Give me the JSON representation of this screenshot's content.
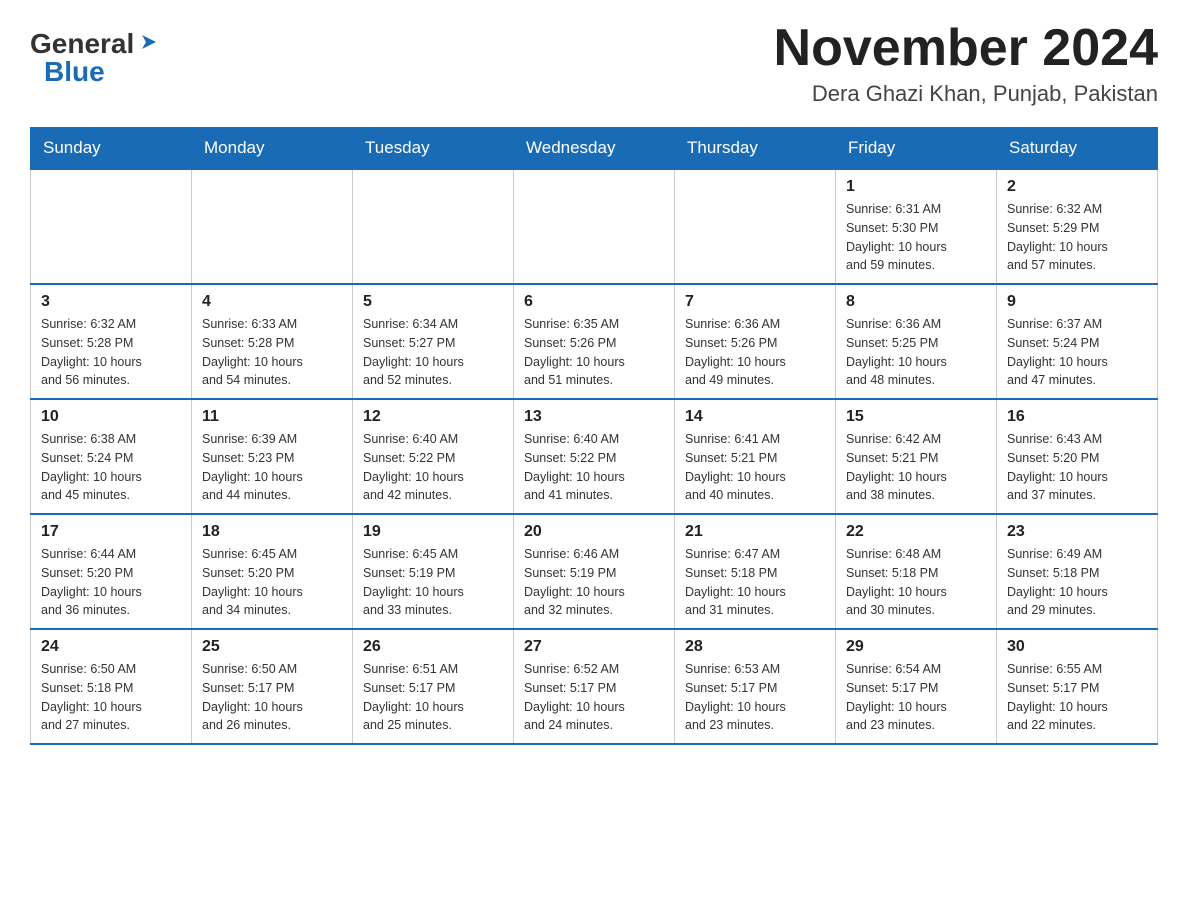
{
  "header": {
    "logo_general": "General",
    "logo_blue": "Blue",
    "month_title": "November 2024",
    "location": "Dera Ghazi Khan, Punjab, Pakistan"
  },
  "calendar": {
    "days_of_week": [
      "Sunday",
      "Monday",
      "Tuesday",
      "Wednesday",
      "Thursday",
      "Friday",
      "Saturday"
    ],
    "weeks": [
      {
        "days": [
          {
            "number": "",
            "info": ""
          },
          {
            "number": "",
            "info": ""
          },
          {
            "number": "",
            "info": ""
          },
          {
            "number": "",
            "info": ""
          },
          {
            "number": "",
            "info": ""
          },
          {
            "number": "1",
            "info": "Sunrise: 6:31 AM\nSunset: 5:30 PM\nDaylight: 10 hours\nand 59 minutes."
          },
          {
            "number": "2",
            "info": "Sunrise: 6:32 AM\nSunset: 5:29 PM\nDaylight: 10 hours\nand 57 minutes."
          }
        ]
      },
      {
        "days": [
          {
            "number": "3",
            "info": "Sunrise: 6:32 AM\nSunset: 5:28 PM\nDaylight: 10 hours\nand 56 minutes."
          },
          {
            "number": "4",
            "info": "Sunrise: 6:33 AM\nSunset: 5:28 PM\nDaylight: 10 hours\nand 54 minutes."
          },
          {
            "number": "5",
            "info": "Sunrise: 6:34 AM\nSunset: 5:27 PM\nDaylight: 10 hours\nand 52 minutes."
          },
          {
            "number": "6",
            "info": "Sunrise: 6:35 AM\nSunset: 5:26 PM\nDaylight: 10 hours\nand 51 minutes."
          },
          {
            "number": "7",
            "info": "Sunrise: 6:36 AM\nSunset: 5:26 PM\nDaylight: 10 hours\nand 49 minutes."
          },
          {
            "number": "8",
            "info": "Sunrise: 6:36 AM\nSunset: 5:25 PM\nDaylight: 10 hours\nand 48 minutes."
          },
          {
            "number": "9",
            "info": "Sunrise: 6:37 AM\nSunset: 5:24 PM\nDaylight: 10 hours\nand 47 minutes."
          }
        ]
      },
      {
        "days": [
          {
            "number": "10",
            "info": "Sunrise: 6:38 AM\nSunset: 5:24 PM\nDaylight: 10 hours\nand 45 minutes."
          },
          {
            "number": "11",
            "info": "Sunrise: 6:39 AM\nSunset: 5:23 PM\nDaylight: 10 hours\nand 44 minutes."
          },
          {
            "number": "12",
            "info": "Sunrise: 6:40 AM\nSunset: 5:22 PM\nDaylight: 10 hours\nand 42 minutes."
          },
          {
            "number": "13",
            "info": "Sunrise: 6:40 AM\nSunset: 5:22 PM\nDaylight: 10 hours\nand 41 minutes."
          },
          {
            "number": "14",
            "info": "Sunrise: 6:41 AM\nSunset: 5:21 PM\nDaylight: 10 hours\nand 40 minutes."
          },
          {
            "number": "15",
            "info": "Sunrise: 6:42 AM\nSunset: 5:21 PM\nDaylight: 10 hours\nand 38 minutes."
          },
          {
            "number": "16",
            "info": "Sunrise: 6:43 AM\nSunset: 5:20 PM\nDaylight: 10 hours\nand 37 minutes."
          }
        ]
      },
      {
        "days": [
          {
            "number": "17",
            "info": "Sunrise: 6:44 AM\nSunset: 5:20 PM\nDaylight: 10 hours\nand 36 minutes."
          },
          {
            "number": "18",
            "info": "Sunrise: 6:45 AM\nSunset: 5:20 PM\nDaylight: 10 hours\nand 34 minutes."
          },
          {
            "number": "19",
            "info": "Sunrise: 6:45 AM\nSunset: 5:19 PM\nDaylight: 10 hours\nand 33 minutes."
          },
          {
            "number": "20",
            "info": "Sunrise: 6:46 AM\nSunset: 5:19 PM\nDaylight: 10 hours\nand 32 minutes."
          },
          {
            "number": "21",
            "info": "Sunrise: 6:47 AM\nSunset: 5:18 PM\nDaylight: 10 hours\nand 31 minutes."
          },
          {
            "number": "22",
            "info": "Sunrise: 6:48 AM\nSunset: 5:18 PM\nDaylight: 10 hours\nand 30 minutes."
          },
          {
            "number": "23",
            "info": "Sunrise: 6:49 AM\nSunset: 5:18 PM\nDaylight: 10 hours\nand 29 minutes."
          }
        ]
      },
      {
        "days": [
          {
            "number": "24",
            "info": "Sunrise: 6:50 AM\nSunset: 5:18 PM\nDaylight: 10 hours\nand 27 minutes."
          },
          {
            "number": "25",
            "info": "Sunrise: 6:50 AM\nSunset: 5:17 PM\nDaylight: 10 hours\nand 26 minutes."
          },
          {
            "number": "26",
            "info": "Sunrise: 6:51 AM\nSunset: 5:17 PM\nDaylight: 10 hours\nand 25 minutes."
          },
          {
            "number": "27",
            "info": "Sunrise: 6:52 AM\nSunset: 5:17 PM\nDaylight: 10 hours\nand 24 minutes."
          },
          {
            "number": "28",
            "info": "Sunrise: 6:53 AM\nSunset: 5:17 PM\nDaylight: 10 hours\nand 23 minutes."
          },
          {
            "number": "29",
            "info": "Sunrise: 6:54 AM\nSunset: 5:17 PM\nDaylight: 10 hours\nand 23 minutes."
          },
          {
            "number": "30",
            "info": "Sunrise: 6:55 AM\nSunset: 5:17 PM\nDaylight: 10 hours\nand 22 minutes."
          }
        ]
      }
    ]
  }
}
